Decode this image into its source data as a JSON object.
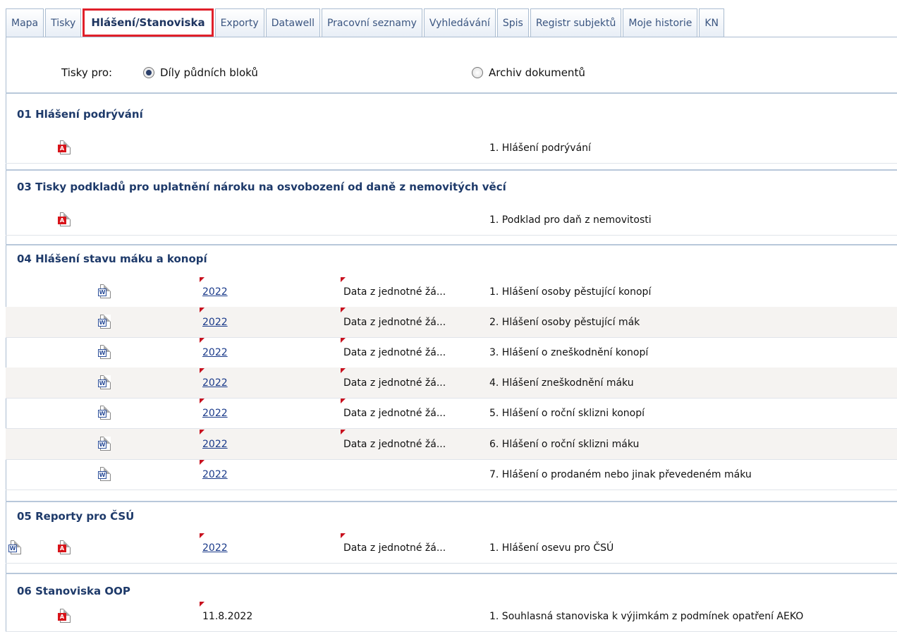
{
  "tabs": [
    {
      "label": "Mapa"
    },
    {
      "label": "Tisky"
    },
    {
      "label": "Hlášení/Stanoviska"
    },
    {
      "label": "Exporty"
    },
    {
      "label": "Datawell"
    },
    {
      "label": "Pracovní seznamy"
    },
    {
      "label": "Vyhledávání"
    },
    {
      "label": "Spis"
    },
    {
      "label": "Registr subjektů"
    },
    {
      "label": "Moje historie"
    },
    {
      "label": "KN"
    }
  ],
  "prints_for": {
    "label": "Tisky pro:",
    "option1": "Díly půdních bloků",
    "option2": "Archiv dokumentů",
    "selected": "Díly půdních bloků"
  },
  "sections": [
    {
      "title": "01 Hlášení podrývání",
      "rows": [
        {
          "word": false,
          "pdf": true,
          "year": "",
          "data": "",
          "name": "1. Hlášení podrývání"
        }
      ]
    },
    {
      "title": "03 Tisky podkladů pro uplatnění nároku na osvobození od daně z nemovitých věcí",
      "rows": [
        {
          "word": false,
          "pdf": true,
          "year": "",
          "data": "",
          "name": "1. Podklad pro daň z nemovitosti"
        }
      ]
    },
    {
      "title": "04 Hlášení stavu máku a konopí",
      "rows": [
        {
          "word": true,
          "pdf": false,
          "year": "2022",
          "data": "Data z jednotné žá...",
          "name": "1. Hlášení osoby pěstující konopí"
        },
        {
          "word": true,
          "pdf": false,
          "year": "2022",
          "data": "Data z jednotné žá...",
          "name": "2. Hlášení osoby pěstující mák"
        },
        {
          "word": true,
          "pdf": false,
          "year": "2022",
          "data": "Data z jednotné žá...",
          "name": "3. Hlášení o zneškodnění konopí"
        },
        {
          "word": true,
          "pdf": false,
          "year": "2022",
          "data": "Data z jednotné žá...",
          "name": "4. Hlášení zneškodnění máku"
        },
        {
          "word": true,
          "pdf": false,
          "year": "2022",
          "data": "Data z jednotné žá...",
          "name": "5. Hlášení o roční sklizni konopí"
        },
        {
          "word": true,
          "pdf": false,
          "year": "2022",
          "data": "Data z jednotné žá...",
          "name": "6. Hlášení o roční sklizni máku"
        },
        {
          "word": true,
          "pdf": false,
          "year": "2022",
          "data": "",
          "name": "7. Hlášení o prodaném nebo jinak převedeném máku"
        }
      ]
    },
    {
      "title": "05 Reporty pro ČSÚ",
      "rows": [
        {
          "word": true,
          "pdf": true,
          "year": "2022",
          "data": "Data z jednotné žá...",
          "name": "1. Hlášení osevu pro ČSÚ"
        }
      ]
    },
    {
      "title": "06 Stanoviska OOP",
      "rows": [
        {
          "word": false,
          "pdf": true,
          "year": "11.8.2022",
          "data": "",
          "name": "1. Souhlasná stanoviska k výjimkám z podmínek opatření AEKO"
        }
      ]
    }
  ],
  "icons": {
    "word_badge": "W",
    "pdf_badge": "A"
  },
  "colors": {
    "active_tab_border": "#e0202a",
    "section_title": "#1e3a6a",
    "link": "#1a3a8a",
    "marker": "#c8101e"
  }
}
